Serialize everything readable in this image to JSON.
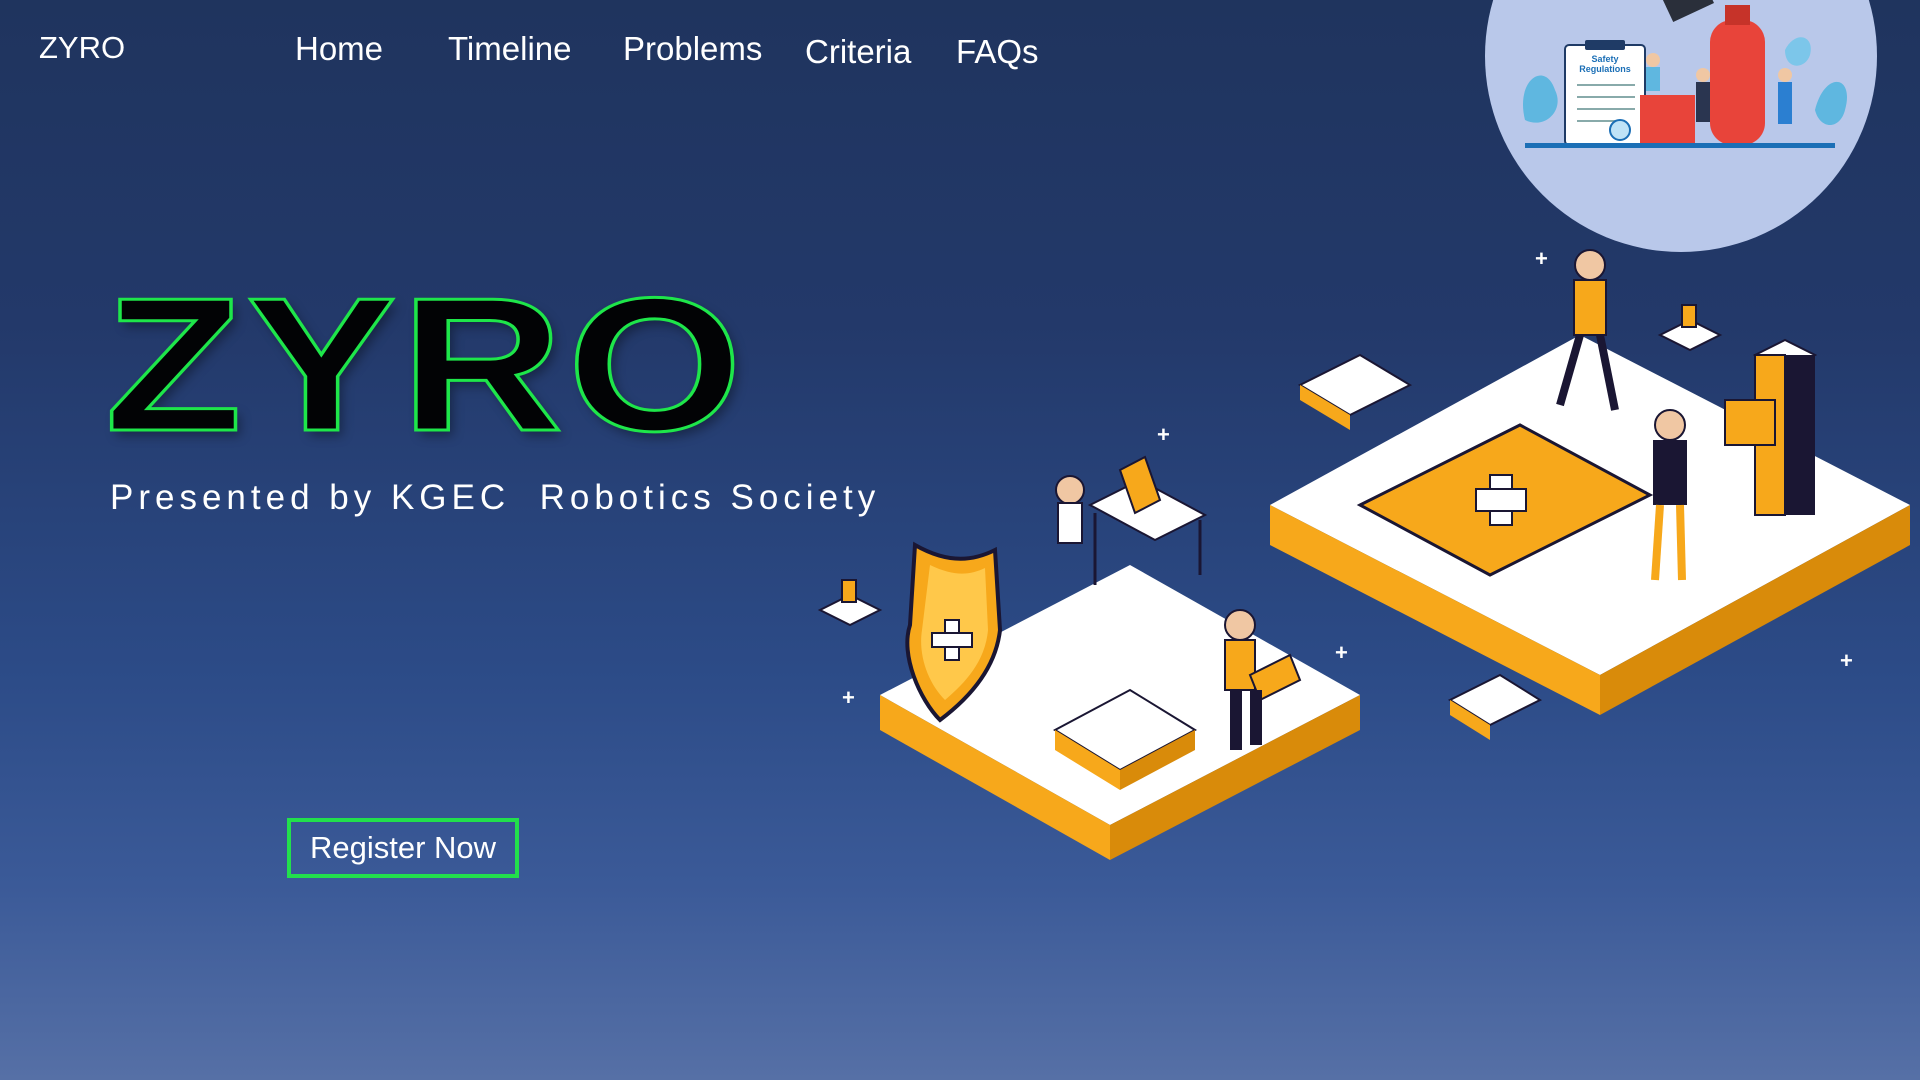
{
  "brand": {
    "name": "ZYRO"
  },
  "nav": {
    "items": [
      {
        "label": "Home"
      },
      {
        "label": "Timeline"
      },
      {
        "label": "Problems"
      },
      {
        "label": "Criteria"
      },
      {
        "label": "FAQs"
      }
    ]
  },
  "hero": {
    "title": "ZYRO",
    "subtitle": "Presented by KGEC  Robotics Society",
    "cta_label": "Register Now"
  },
  "badge_illustration": {
    "sign_text_line1": "Safety",
    "sign_text_line2": "Regulations"
  },
  "colors": {
    "accent_green": "#22e04c",
    "background_top": "#1f345e",
    "background_bottom": "#5670a6",
    "illustration_orange": "#f7a81b"
  }
}
